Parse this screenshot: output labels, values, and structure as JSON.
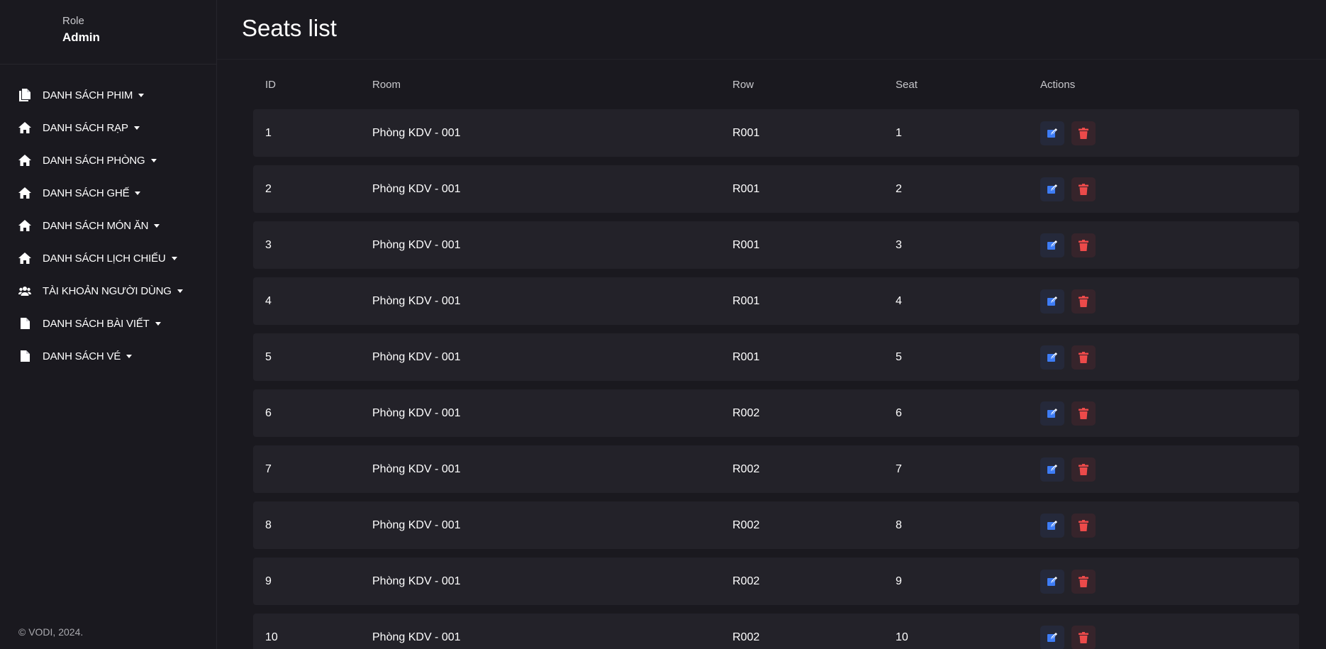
{
  "sidebar": {
    "role_caption": "Role",
    "role_name": "Admin",
    "items": [
      {
        "label": "DANH SÁCH PHIM",
        "icon": "documents-icon"
      },
      {
        "label": "DANH SÁCH RẠP",
        "icon": "home-icon"
      },
      {
        "label": "DANH SÁCH PHÒNG",
        "icon": "home-icon"
      },
      {
        "label": "DANH SÁCH GHẾ",
        "icon": "home-icon"
      },
      {
        "label": "DANH SÁCH MÓN ĂN",
        "icon": "home-icon"
      },
      {
        "label": "DANH SÁCH LỊCH CHIẾU",
        "icon": "home-icon"
      },
      {
        "label": "TÀI KHOẢN NGƯỜI DÙNG",
        "icon": "users-icon"
      },
      {
        "label": "DANH SÁCH BÀI VIẾT",
        "icon": "file-icon"
      },
      {
        "label": "DANH SÁCH VÉ",
        "icon": "file-icon"
      }
    ],
    "footer": "© VODI, 2024."
  },
  "page": {
    "title": "Seats list"
  },
  "table": {
    "headers": {
      "id": "ID",
      "room": "Room",
      "row": "Row",
      "seat": "Seat",
      "actions": "Actions"
    },
    "rows": [
      {
        "id": "1",
        "room": "Phòng KDV - 001",
        "row": "R001",
        "seat": "1"
      },
      {
        "id": "2",
        "room": "Phòng KDV - 001",
        "row": "R001",
        "seat": "2"
      },
      {
        "id": "3",
        "room": "Phòng KDV - 001",
        "row": "R001",
        "seat": "3"
      },
      {
        "id": "4",
        "room": "Phòng KDV - 001",
        "row": "R001",
        "seat": "4"
      },
      {
        "id": "5",
        "room": "Phòng KDV - 001",
        "row": "R001",
        "seat": "5"
      },
      {
        "id": "6",
        "room": "Phòng KDV - 001",
        "row": "R002",
        "seat": "6"
      },
      {
        "id": "7",
        "room": "Phòng KDV - 001",
        "row": "R002",
        "seat": "7"
      },
      {
        "id": "8",
        "room": "Phòng KDV - 001",
        "row": "R002",
        "seat": "8"
      },
      {
        "id": "9",
        "room": "Phòng KDV - 001",
        "row": "R002",
        "seat": "9"
      },
      {
        "id": "10",
        "room": "Phòng KDV - 001",
        "row": "R002",
        "seat": "10"
      }
    ]
  },
  "colors": {
    "background": "#1a191f",
    "row_background": "#232229",
    "edit_accent": "#3d7cf5",
    "delete_accent": "#ec4a4a"
  }
}
